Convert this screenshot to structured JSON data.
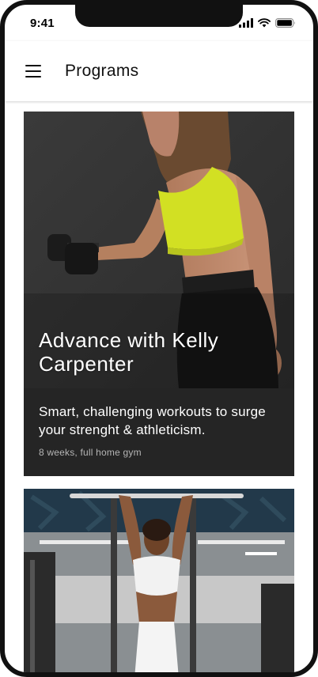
{
  "status_bar": {
    "time": "9:41"
  },
  "app_bar": {
    "title": "Programs",
    "menu_icon": "hamburger-menu-icon"
  },
  "programs": [
    {
      "title": "Advance with Kelly Carpenter",
      "description": "Smart, challenging workouts to surge your strenght & athleticism.",
      "meta": "8 weeks, full home gym",
      "image": "woman-lifting-dumbbell"
    },
    {
      "image": "woman-gym-pullup"
    }
  ],
  "colors": {
    "card_dark": "#252525",
    "accent_top": "#d8e62d"
  }
}
